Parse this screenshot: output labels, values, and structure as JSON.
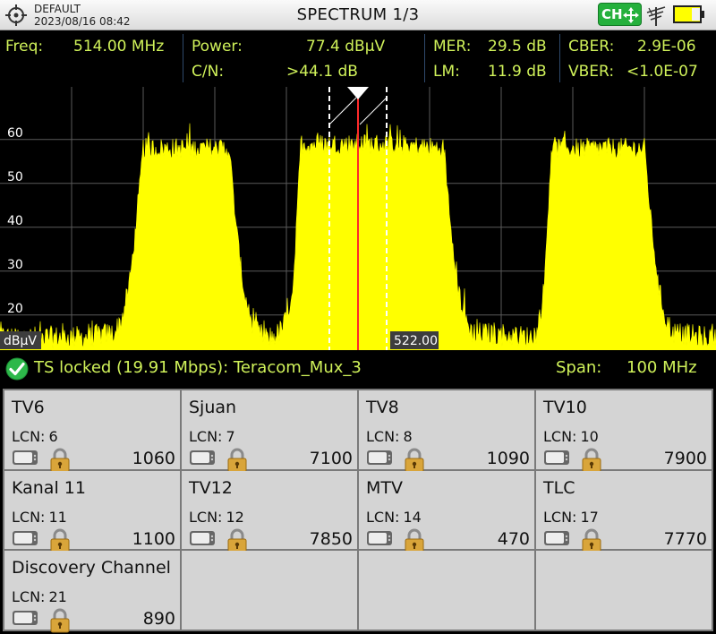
{
  "titlebar": {
    "profile": "DEFAULT",
    "datetime": "2023/08/16 08:42",
    "title": "SPECTRUM 1/3",
    "ch_button": "CH"
  },
  "measurements": {
    "freq_label": "Freq:",
    "freq_value": "514.00 MHz",
    "power_label": "Power:",
    "power_value": "77.4 dBµV",
    "cn_label": "C/N:",
    "cn_value": ">44.1 dB",
    "mer_label": "MER:",
    "mer_value": "29.5 dB",
    "lm_label": "LM:",
    "lm_value": "11.9 dB",
    "cber_label": "CBER:",
    "cber_value": "2.9E-06",
    "vber_label": "VBER:",
    "vber_value": "<1.0E-07"
  },
  "spectrum": {
    "y_ticks": [
      "60",
      "50",
      "40",
      "30",
      "20"
    ],
    "unit_label": "dBµV",
    "marker_label": "522.00",
    "trace_color": "#ffff00",
    "marker_color": "#ff2a2a"
  },
  "chart_data": {
    "type": "area",
    "ylabel": "dBµV",
    "y_ticks": [
      60,
      50,
      40,
      30,
      20
    ],
    "ylim": [
      12,
      72
    ],
    "span_mhz": 100,
    "center_freq_mhz": 514.0,
    "xlim_mhz": [
      464,
      564
    ],
    "marker_freq_mhz": 522.0,
    "channel_window_mhz": [
      510,
      518
    ],
    "noise_floor_dbuv": 15,
    "grid": true,
    "series": [
      {
        "x_mhz": [
          464,
          468,
          472,
          476,
          480,
          481,
          482,
          483,
          484,
          496,
          497,
          498,
          499,
          500,
          501,
          502,
          503,
          504,
          505,
          506,
          510,
          518,
          526,
          527,
          528,
          529,
          530,
          538,
          539,
          540,
          541,
          542,
          554,
          555,
          556,
          557,
          558,
          562,
          564
        ],
        "y_dbuv": [
          15,
          15,
          15,
          15,
          16,
          19,
          26,
          40,
          58,
          58,
          40,
          26,
          19,
          16,
          15,
          15,
          16,
          19,
          27,
          59,
          59,
          59,
          58,
          40,
          26,
          19,
          16,
          15,
          16,
          26,
          58,
          58,
          58,
          40,
          26,
          19,
          16,
          15,
          15
        ]
      }
    ]
  },
  "status": {
    "ts_status": "TS locked (19.91 Mbps): Teracom_Mux_3",
    "span_label": "Span:",
    "span_value": "100 MHz",
    "ok_color": "#2db84a"
  },
  "services": [
    {
      "name": "TV6",
      "lcn_label": "LCN:",
      "lcn": "6",
      "sid": "1060"
    },
    {
      "name": "Sjuan",
      "lcn_label": "LCN:",
      "lcn": "7",
      "sid": "7100"
    },
    {
      "name": "TV8",
      "lcn_label": "LCN:",
      "lcn": "8",
      "sid": "1090"
    },
    {
      "name": "TV10",
      "lcn_label": "LCN:",
      "lcn": "10",
      "sid": "7900"
    },
    {
      "name": "Kanal 11",
      "lcn_label": "LCN:",
      "lcn": "11",
      "sid": "1100"
    },
    {
      "name": "TV12",
      "lcn_label": "LCN:",
      "lcn": "12",
      "sid": "7850"
    },
    {
      "name": "MTV",
      "lcn_label": "LCN:",
      "lcn": "14",
      "sid": "470"
    },
    {
      "name": "TLC",
      "lcn_label": "LCN:",
      "lcn": "17",
      "sid": "7770"
    },
    {
      "name": "Discovery Channel",
      "lcn_label": "LCN:",
      "lcn": "21",
      "sid": "890"
    }
  ]
}
